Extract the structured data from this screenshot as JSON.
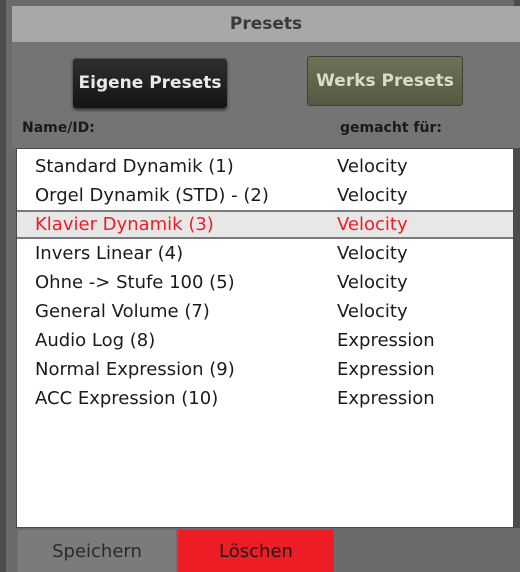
{
  "title": "Presets",
  "buttons": {
    "eigene": "Eigene Presets",
    "werks": "Werks Presets"
  },
  "columns": {
    "name": "Name/ID:",
    "made_for": "gemacht für:"
  },
  "presets": [
    {
      "name": "Standard Dynamik (1)",
      "for": "Velocity"
    },
    {
      "name": "Orgel Dynamik (STD) - (2)",
      "for": "Velocity"
    },
    {
      "name": "Klavier Dynamik (3)",
      "for": "Velocity",
      "selected": true
    },
    {
      "name": "Invers Linear (4)",
      "for": "Velocity"
    },
    {
      "name": "Ohne -> Stufe 100 (5)",
      "for": "Velocity"
    },
    {
      "name": "General Volume (7)",
      "for": "Velocity"
    },
    {
      "name": "Audio Log (8)",
      "for": "Expression"
    },
    {
      "name": "Normal Expression (9)",
      "for": "Expression"
    },
    {
      "name": "ACC Expression (10)",
      "for": "Expression"
    }
  ],
  "bottom": {
    "save": "Speichern",
    "delete": "Löschen"
  },
  "colors": {
    "selected_text": "#ee1c25",
    "delete_button": "#ee1c25"
  }
}
